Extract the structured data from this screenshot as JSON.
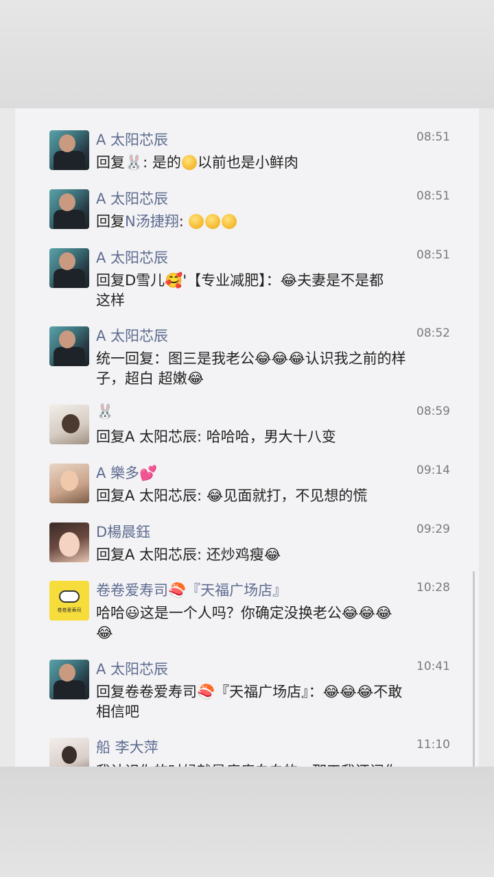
{
  "messages": [
    {
      "name": "A 太阳芯辰",
      "time": "08:51",
      "parts": [
        "回复",
        "🐰",
        ": 是的",
        "😂",
        "以前也是小鲜肉"
      ]
    },
    {
      "name": "A 太阳芯辰",
      "time": "08:51",
      "parts": [
        "回复",
        "N汤捷翔",
        ": ",
        "😔😔😔"
      ]
    },
    {
      "name": "A 太阳芯辰",
      "time": "08:51",
      "line1": "回复D雪儿🥰'【专业减肥】：😂夫妻是不是都",
      "line2": "这样"
    },
    {
      "name": "A 太阳芯辰",
      "time": "08:52",
      "line1": "统一回复：图三是我老公😂😂😂认识我之前的样",
      "line2": "子，超白 超嫩😂"
    },
    {
      "name": "🐰",
      "time": "08:59",
      "line1": "回复A 太阳芯辰: 哈哈哈，男大十八变"
    },
    {
      "name": "A 樂多💕",
      "time": "09:14",
      "line1": "回复A 太阳芯辰: 😂见面就打，不见想的慌"
    },
    {
      "name": "D楊晨鈺",
      "time": "09:29",
      "line1": "回复A 太阳芯辰: 还炒鸡瘦😂"
    },
    {
      "name": "卷卷爱寿司🍣『天福广场店』",
      "time": "10:28",
      "line1": "哈哈😃这是一个人吗？你确定没换老公😂😂😂",
      "line2": "😂"
    },
    {
      "name": "A 太阳芯辰",
      "time": "10:41",
      "line1": "回复卷卷爱寿司🍣『天福广场店』：😂😂😂不敢",
      "line2": "相信吧"
    },
    {
      "name": "船 李大萍",
      "time": "11:10",
      "line1": "我认识你的时候就是瘦瘦白白的，那天我还问你..."
    }
  ],
  "sushi_avatar_label": "卷卷爱寿司"
}
